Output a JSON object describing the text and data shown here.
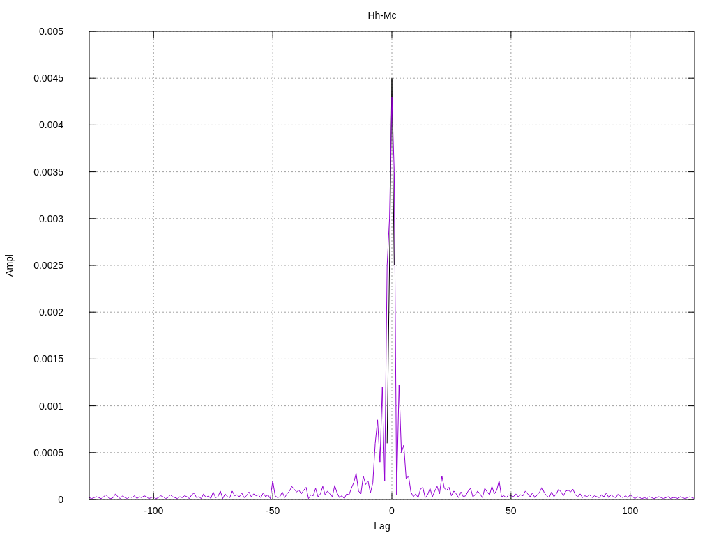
{
  "chart_data": {
    "type": "line",
    "grid": true,
    "title": "Hh-Mc",
    "xlabel": "Lag",
    "ylabel": "Ampl",
    "xlim": [
      -127,
      127
    ],
    "ylim": [
      0,
      0.005
    ],
    "xticks": [
      -100,
      -50,
      0,
      50,
      100
    ],
    "yticks": [
      0,
      0.0005,
      0.001,
      0.0015,
      0.002,
      0.0025,
      0.003,
      0.0035,
      0.004,
      0.0045,
      0.005
    ],
    "x": [
      -127,
      -126,
      -125,
      -124,
      -123,
      -122,
      -121,
      -120,
      -119,
      -118,
      -117,
      -116,
      -115,
      -114,
      -113,
      -112,
      -111,
      -110,
      -109,
      -108,
      -107,
      -106,
      -105,
      -104,
      -103,
      -102,
      -101,
      -100,
      -99,
      -98,
      -97,
      -96,
      -95,
      -94,
      -93,
      -92,
      -91,
      -90,
      -89,
      -88,
      -87,
      -86,
      -85,
      -84,
      -83,
      -82,
      -81,
      -80,
      -79,
      -78,
      -77,
      -76,
      -75,
      -74,
      -73,
      -72,
      -71,
      -70,
      -69,
      -68,
      -67,
      -66,
      -65,
      -64,
      -63,
      -62,
      -61,
      -60,
      -59,
      -58,
      -57,
      -56,
      -55,
      -54,
      -53,
      -52,
      -51,
      -50,
      -49,
      -48,
      -47,
      -46,
      -45,
      -44,
      -43,
      -42,
      -41,
      -40,
      -39,
      -38,
      -37,
      -36,
      -35,
      -34,
      -33,
      -32,
      -31,
      -30,
      -29,
      -28,
      -27,
      -26,
      -25,
      -24,
      -23,
      -22,
      -21,
      -20,
      -19,
      -18,
      -17,
      -16,
      -15,
      -14,
      -13,
      -12,
      -11,
      -10,
      -9,
      -8,
      -7,
      -6,
      -5,
      -4,
      -3,
      -2,
      -1,
      0,
      1,
      2,
      3,
      4,
      5,
      6,
      7,
      8,
      9,
      10,
      11,
      12,
      13,
      14,
      15,
      16,
      17,
      18,
      19,
      20,
      21,
      22,
      23,
      24,
      25,
      26,
      27,
      28,
      29,
      30,
      31,
      32,
      33,
      34,
      35,
      36,
      37,
      38,
      39,
      40,
      41,
      42,
      43,
      44,
      45,
      46,
      47,
      48,
      49,
      50,
      51,
      52,
      53,
      54,
      55,
      56,
      57,
      58,
      59,
      60,
      61,
      62,
      63,
      64,
      65,
      66,
      67,
      68,
      69,
      70,
      71,
      72,
      73,
      74,
      75,
      76,
      77,
      78,
      79,
      80,
      81,
      82,
      83,
      84,
      85,
      86,
      87,
      88,
      89,
      90,
      91,
      92,
      93,
      94,
      95,
      96,
      97,
      98,
      99,
      100,
      101,
      102,
      103,
      104,
      105,
      106,
      107,
      108,
      109,
      110,
      111,
      112,
      113,
      114,
      115,
      116,
      117,
      118,
      119,
      120,
      121,
      122,
      123,
      124,
      125,
      126,
      127
    ],
    "series": [
      {
        "color": "#000000",
        "x": [
          -2,
          -1,
          0,
          1
        ],
        "values": [
          0.0006,
          0.0025,
          0.0045,
          0.0025
        ]
      },
      {
        "color": "#9400d3",
        "values": [
          2e-05,
          1e-05,
          2e-05,
          3e-05,
          2e-05,
          1e-05,
          3e-05,
          5e-05,
          2e-05,
          1e-05,
          2e-05,
          6e-05,
          3e-05,
          1e-05,
          4e-05,
          2e-05,
          1e-05,
          3e-05,
          2e-05,
          4e-05,
          1e-05,
          3e-05,
          2e-05,
          4e-05,
          3e-05,
          1e-05,
          2e-05,
          3e-05,
          1e-05,
          2e-05,
          4e-05,
          3e-05,
          1e-05,
          2e-05,
          5e-05,
          3e-05,
          2e-05,
          1e-05,
          3e-05,
          2e-05,
          4e-05,
          3e-05,
          1e-05,
          5e-05,
          7e-05,
          2e-05,
          3e-05,
          1e-05,
          6e-05,
          2e-05,
          4e-05,
          1e-05,
          8e-05,
          2e-05,
          3e-05,
          9e-05,
          1e-05,
          6e-05,
          3e-05,
          2e-05,
          9e-05,
          4e-05,
          5e-05,
          3e-05,
          7e-05,
          2e-05,
          4e-05,
          8e-05,
          3e-05,
          6e-05,
          4e-05,
          5e-05,
          2e-05,
          7e-05,
          3e-05,
          5e-05,
          1e-05,
          0.0002,
          4e-05,
          2e-05,
          3e-05,
          8e-05,
          2e-05,
          6e-05,
          9e-05,
          0.00014,
          0.00011,
          8e-05,
          0.0001,
          6e-05,
          0.0001,
          0.00013,
          1e-05,
          5e-05,
          4e-05,
          0.00012,
          3e-05,
          6e-05,
          0.00014,
          5e-05,
          9e-05,
          6e-05,
          3e-05,
          0.00015,
          7e-05,
          2e-05,
          4e-05,
          1e-05,
          6e-05,
          5e-05,
          0.00012,
          0.00018,
          0.00028,
          9e-05,
          6e-05,
          0.00025,
          0.00016,
          0.0002,
          7e-05,
          0.00018,
          0.0006,
          0.00085,
          0.0004,
          0.0012,
          0.0002,
          0.0025,
          0.003,
          0.0043,
          0.0035,
          5e-05,
          0.00122,
          0.0005,
          0.00058,
          0.00022,
          0.00025,
          8e-05,
          3e-05,
          6e-05,
          2e-05,
          0.00011,
          0.00013,
          2e-05,
          5e-05,
          0.00012,
          3e-05,
          9e-05,
          0.00014,
          6e-05,
          0.00025,
          0.00012,
          0.0001,
          0.00013,
          4e-05,
          9e-05,
          6e-05,
          2e-05,
          8e-05,
          3e-05,
          4e-05,
          9e-05,
          0.00012,
          3e-05,
          5e-05,
          9e-05,
          6e-05,
          2e-05,
          0.00012,
          8e-05,
          5e-05,
          0.00014,
          6e-05,
          0.0001,
          0.0002,
          3e-05,
          4e-05,
          2e-05,
          5e-05,
          4e-05,
          3e-05,
          6e-05,
          3e-05,
          5e-05,
          4e-05,
          9e-05,
          6e-05,
          3e-05,
          7e-05,
          2e-05,
          5e-05,
          8e-05,
          0.00013,
          7e-05,
          4e-05,
          2e-05,
          8e-05,
          3e-05,
          6e-05,
          0.00011,
          8e-05,
          4e-05,
          9e-05,
          0.0001,
          8e-05,
          0.00011,
          5e-05,
          3e-05,
          6e-05,
          2e-05,
          4e-05,
          3e-05,
          5e-05,
          2e-05,
          4e-05,
          3e-05,
          2e-05,
          5e-05,
          3e-05,
          7e-05,
          2e-05,
          5e-05,
          3e-05,
          2e-05,
          6e-05,
          3e-05,
          2e-05,
          4e-05,
          2e-05,
          5e-05,
          3e-05,
          1e-05,
          3e-05,
          2e-05,
          1e-05,
          2e-05,
          1e-05,
          3e-05,
          2e-05,
          1e-05,
          2e-05,
          3e-05,
          2e-05,
          1e-05,
          2e-05,
          3e-05,
          1e-05,
          2e-05,
          2e-05,
          1e-05,
          3e-05,
          2e-05,
          1e-05,
          2e-05,
          3e-05,
          2e-05,
          1e-05
        ]
      }
    ]
  }
}
